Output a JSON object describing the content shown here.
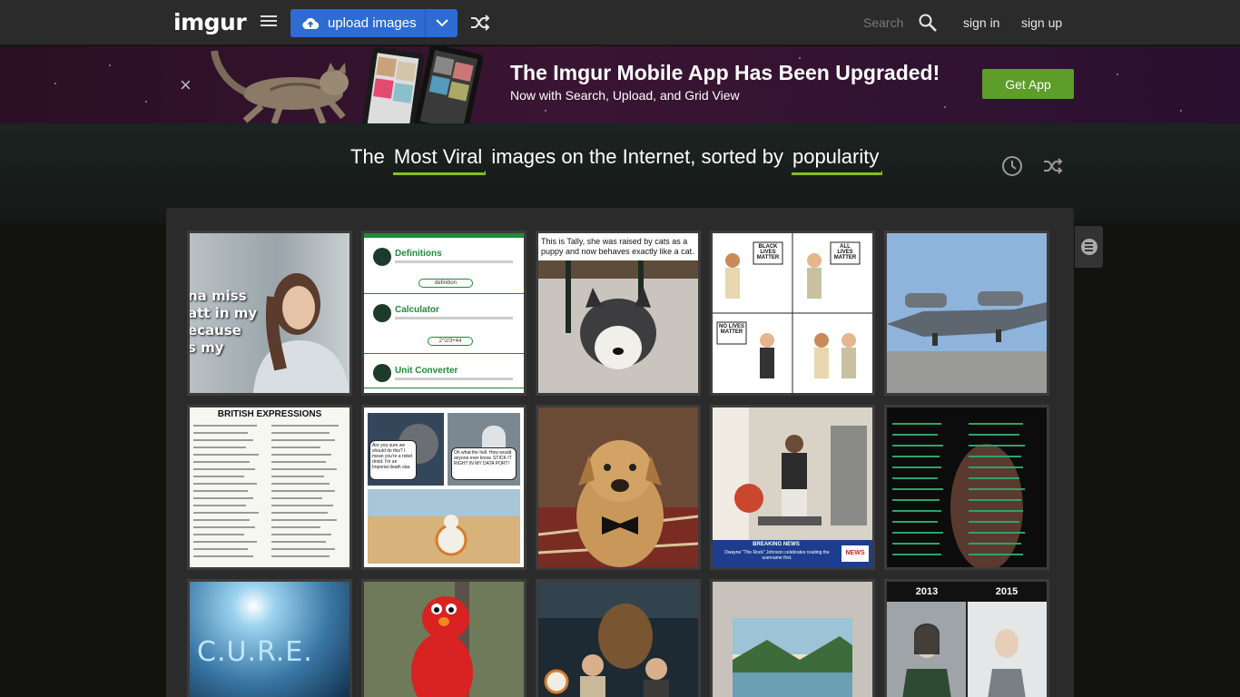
{
  "nav": {
    "logo": "imgur",
    "upload_label": "upload images",
    "search_label": "Search",
    "sign_in": "sign in",
    "sign_up": "sign up"
  },
  "banner": {
    "title": "The Imgur Mobile App Has Been Upgraded!",
    "subtitle": "Now with Search, Upload, and Grid View",
    "cta": "Get App",
    "close": "×"
  },
  "heading": {
    "prefix": "The",
    "section": "Most Viral",
    "middle": "images on the Internet, sorted by",
    "sort": "popularity"
  },
  "thumbs": [
    {
      "text": "na miss\natt in my\necause\ns my"
    },
    {
      "title1": "Definitions",
      "title2": "Calculator",
      "title3": "Unit Converter",
      "word": "definition",
      "formula": "2^2/3+44"
    },
    {
      "caption": "This is Tally, she was raised by cats as a puppy and now behaves exactly like a cat."
    },
    {
      "sign1": "BLACK LIVES MATTER",
      "sign2": "ALL LIVES MATTER",
      "sign3": "NO LIVES MATTER"
    },
    {},
    {
      "title": "BRITISH EXPRESSIONS"
    },
    {
      "bubble1": "Are you sure we should do this? I mean you're a rebel droid. I'm an Imperial death star.",
      "bubble2": "Oh what the hell. How would anyone ever know. STICK IT RIGHT IN MY DATA PORT!"
    },
    {},
    {
      "news_title": "BREAKING NEWS",
      "news_text": "Dwayne \"The Rock\" Johnson celebrates reading the username first.",
      "news_logo": "NEWS"
    },
    {},
    {
      "text": "C.U.R.E."
    },
    {},
    {},
    {},
    {
      "year1": "2013",
      "year2": "2015"
    }
  ],
  "colors": {
    "accent_green": "#85bf25",
    "upload_blue": "#2e6bd3",
    "get_app_green": "#5d9d2a"
  }
}
